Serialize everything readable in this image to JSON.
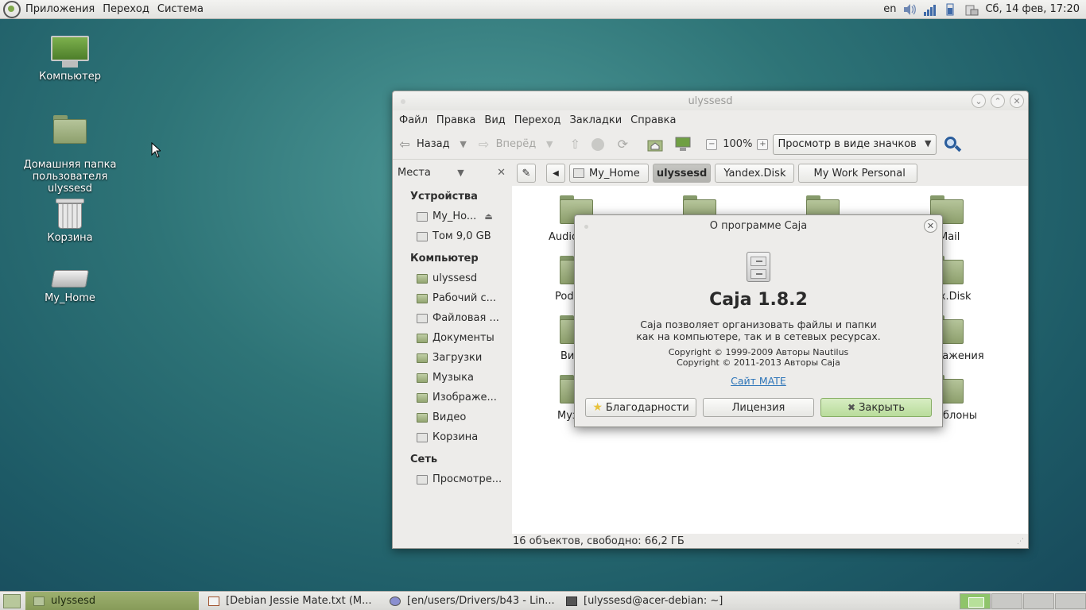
{
  "top_panel": {
    "menus": [
      "Приложения",
      "Переход",
      "Система"
    ],
    "keyboard_layout": "en",
    "datetime": "Сб, 14 фев, 17:20"
  },
  "desktop": {
    "icons": [
      {
        "label": "Компьютер"
      },
      {
        "label": "Домашняя папка\nпользователя\nulyssesd"
      },
      {
        "label": "Корзина"
      },
      {
        "label": "My_Home"
      }
    ]
  },
  "window": {
    "title": "ulyssesd",
    "menus": [
      "Файл",
      "Правка",
      "Вид",
      "Переход",
      "Закладки",
      "Справка"
    ],
    "toolbar": {
      "back_label": "Назад",
      "forward_label": "Вперёд",
      "zoom": "100%",
      "view_mode": "Просмотр в виде значков"
    },
    "sidebar": {
      "title": "Места",
      "sections": [
        {
          "name": "Устройства",
          "items": [
            "My_Ho...",
            "Том 9,0 GB"
          ]
        },
        {
          "name": "Компьютер",
          "items": [
            "ulyssesd",
            "Рабочий с...",
            "Файловая ...",
            "Документы",
            "Загрузки",
            "Музыка",
            "Изображе...",
            "Видео",
            "Корзина"
          ]
        },
        {
          "name": "Сеть",
          "items": [
            "Просмотре..."
          ]
        }
      ]
    },
    "pathbar": [
      "My_Home",
      "ulyssesd",
      "Yandex.Disk",
      "My Work Personal"
    ],
    "visible_file_labels": [
      "Audio",
      "Mail",
      "Pod",
      "ex.Disk",
      "Ви",
      "ражения",
      "Муз",
      "блоны"
    ],
    "status": "16 объектов, свободно: 66,2 ГБ"
  },
  "about_dialog": {
    "title": "О программе Caja",
    "app_name": "Caja 1.8.2",
    "description_line1": "Caja позволяет организовать файлы и папки",
    "description_line2": "как на компьютере, так и в сетевых ресурсах.",
    "copyright1": "Copyright © 1999-2009 Авторы Nautilus",
    "copyright2": "Copyright © 2011-2013 Авторы Caja",
    "link": "Сайт MATE",
    "buttons": {
      "credits": "Благодарности",
      "license": "Лицензия",
      "close": "Закрыть"
    }
  },
  "taskbar": {
    "tasks": [
      "ulyssesd",
      "[Debian Jessie Mate.txt (M...",
      "[en/users/Drivers/b43 - Lin...",
      "[ulyssesd@acer-debian: ~]"
    ]
  },
  "colors": {
    "accent_green": "#8ea06d",
    "link_blue": "#2c74b8"
  }
}
